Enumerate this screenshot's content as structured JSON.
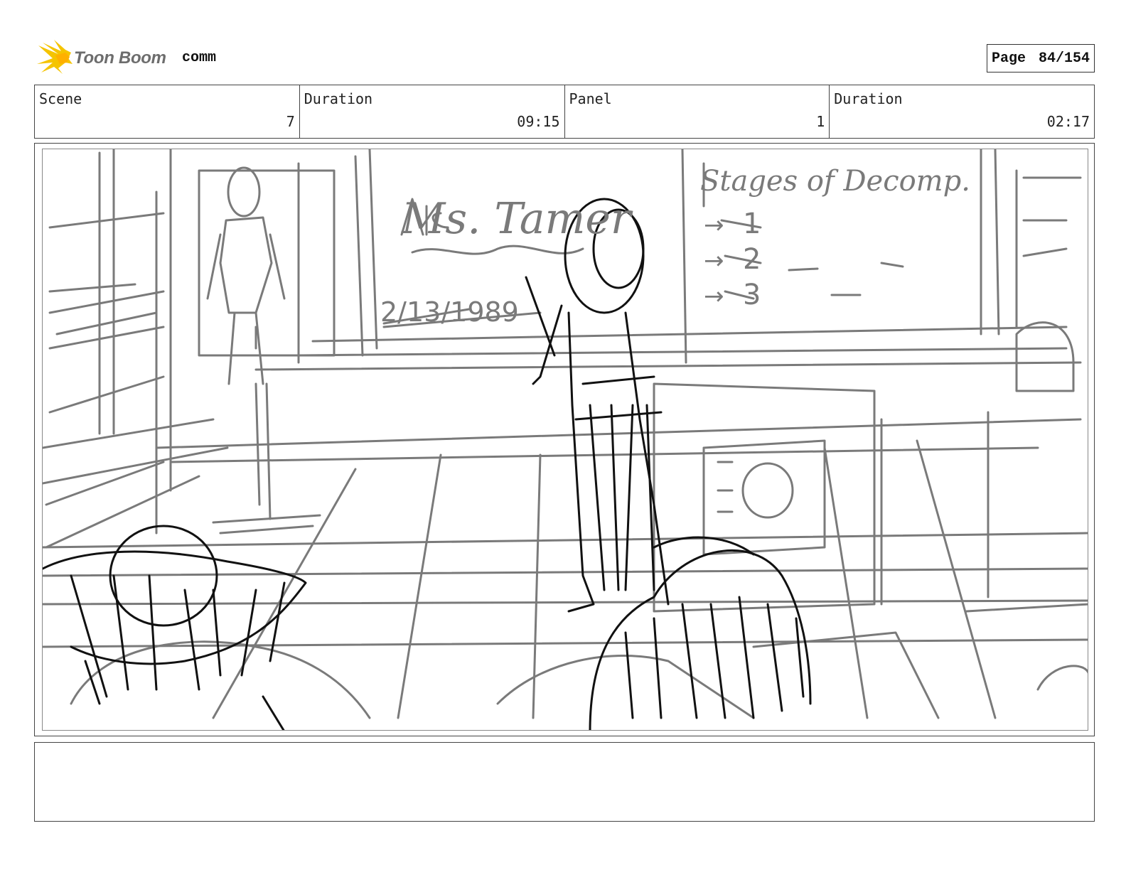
{
  "header": {
    "logo_text": "Toon Boom",
    "project_name": "comm",
    "page_label": "Page",
    "page_number": "84/154"
  },
  "info": [
    {
      "label": "Scene",
      "value": "7"
    },
    {
      "label": "Duration",
      "value": "09:15"
    },
    {
      "label": "Panel",
      "value": "1"
    },
    {
      "label": "Duration",
      "value": "02:17"
    }
  ],
  "panel": {
    "board_name": "Ms. Tamer",
    "board_date": "2/13/1989",
    "board_heading": "Stages of Decomp.",
    "board_items": [
      "1",
      "2",
      "3"
    ]
  },
  "notes": "",
  "colors": {
    "border": "#444444",
    "sketch_light": "#7a7a7a",
    "sketch_dark": "#111111",
    "logo_yellow": "#f5c400"
  }
}
